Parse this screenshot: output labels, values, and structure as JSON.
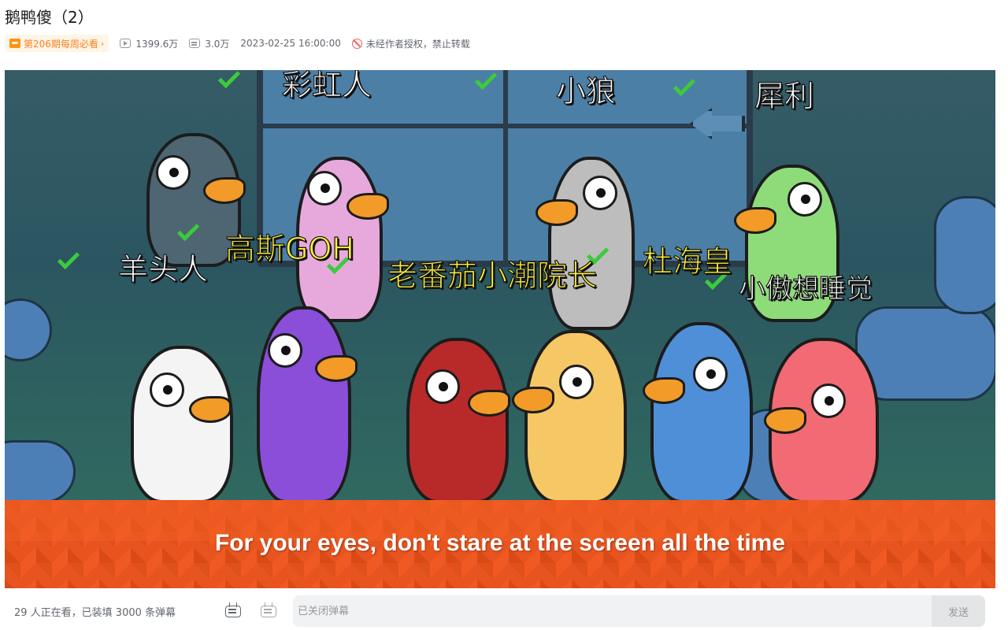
{
  "video": {
    "title": "鹅鸭傻（2）",
    "weekly_badge": "第206期每周必看",
    "badge_chevron": "›",
    "views": "1399.6万",
    "danmaku_count": "3.0万",
    "publish_time": "2023-02-25 16:00:00",
    "copyright_notice": "未经作者授权，禁止转载"
  },
  "frame": {
    "labels": [
      {
        "text": "彩虹人",
        "style": "white"
      },
      {
        "text": "小狼",
        "style": "white"
      },
      {
        "text": "犀利",
        "style": "white"
      },
      {
        "text": "羊头人",
        "style": "white"
      },
      {
        "text": "高斯GOH",
        "style": "yellow"
      },
      {
        "text": "老番茄小潮院长",
        "style": "yellow"
      },
      {
        "text": "杜海皇",
        "style": "yellow"
      },
      {
        "text": "小傲想睡觉",
        "style": "white"
      }
    ],
    "subtitle": "For your eyes, don't stare at the screen all the time"
  },
  "danmaku_bar": {
    "viewers_text": "29 人正在看，已装填 3000 条弹幕",
    "input_placeholder": "已关闭弹幕",
    "send_label": "发送"
  },
  "icons": {
    "badge": "calendar-icon",
    "views": "play-count-icon",
    "danmaku": "danmaku-count-icon",
    "copyright": "no-repost-icon",
    "toggle_on": "danmaku-on-icon",
    "toggle_off": "danmaku-off-icon"
  },
  "colors": {
    "badge_text": "#ff7f24",
    "badge_bg": "#fdf6e6",
    "warning": "#f25d59",
    "subtitle_band": "#e85420"
  }
}
